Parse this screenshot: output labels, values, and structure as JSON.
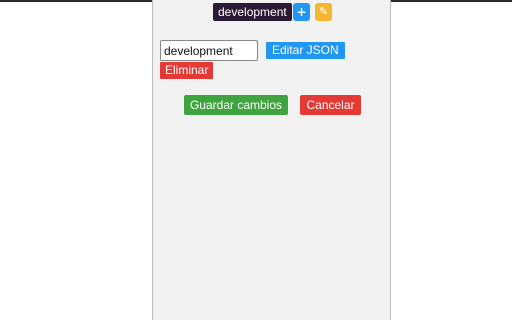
{
  "header": {
    "environment_badge": "development",
    "add_button": {
      "label": "+",
      "icon": "plus-icon"
    },
    "edit_button": {
      "label": "✎",
      "icon": "pencil-icon"
    }
  },
  "form": {
    "name_field": {
      "value": "development"
    },
    "edit_json_label": "Editar JSON",
    "delete_label": "Eliminar"
  },
  "actions": {
    "save_label": "Guardar cambios",
    "cancel_label": "Cancelar"
  },
  "colors": {
    "badge": "#2b1a35",
    "primary": "#2196f3",
    "warning": "#f4b630",
    "danger": "#e53935",
    "success": "#3fa33f",
    "panel_bg": "#f2f2f2"
  }
}
